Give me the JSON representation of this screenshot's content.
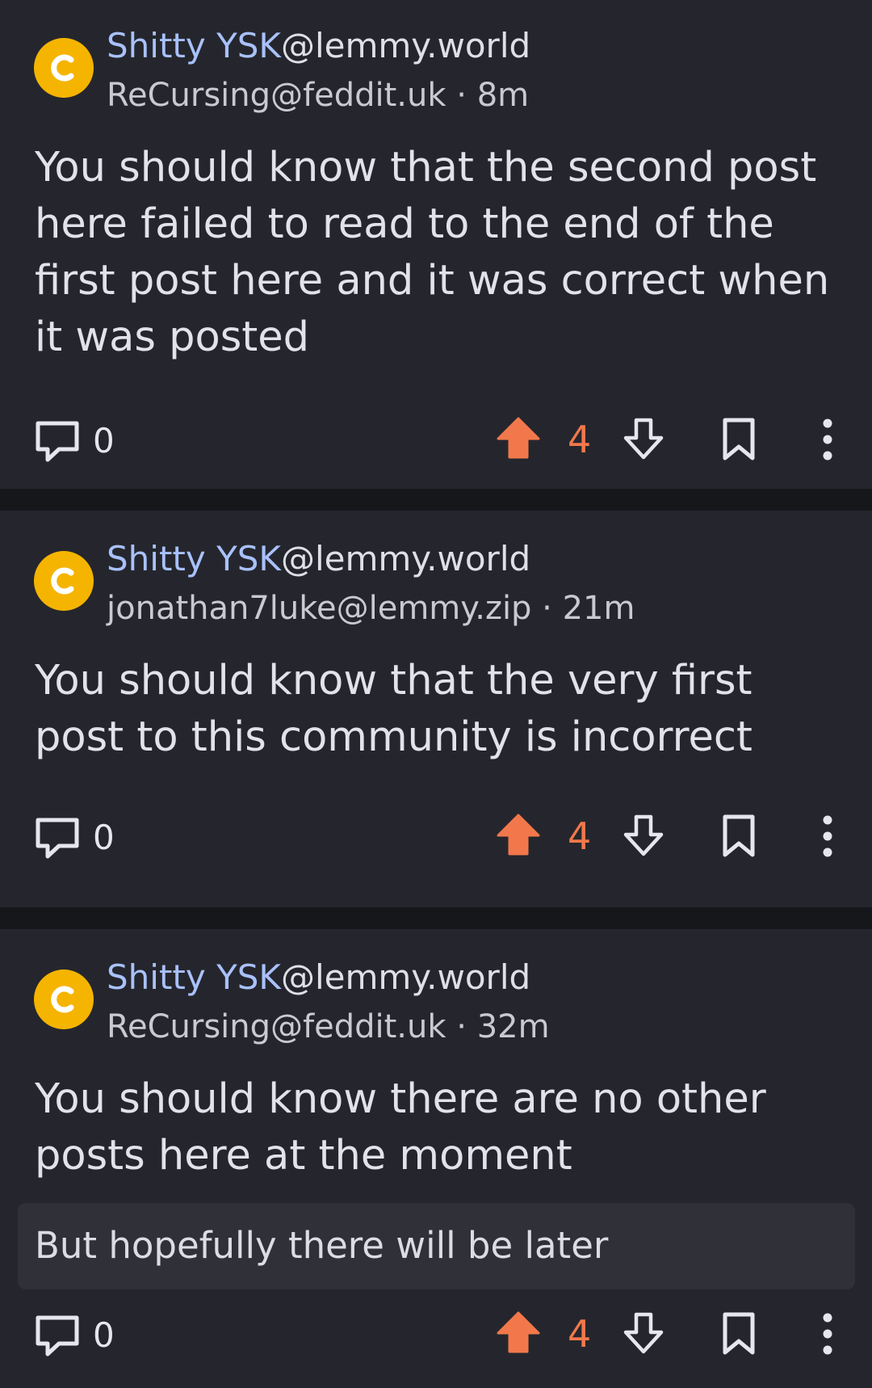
{
  "colors": {
    "background": "#16171b",
    "card": "#25262d",
    "community_name": "#a9c1fb",
    "upvote_accent": "#f2784b",
    "avatar": "#f5b400",
    "body_box": "#2f3038"
  },
  "posts": [
    {
      "avatar_letter": "c",
      "community_name": "Shitty YSK",
      "community_instance": "@lemmy.world",
      "author": "ReCursing@feddit.uk",
      "separator": "·",
      "age": "8m",
      "title": "You should know that the second post here failed to read to the end of the first post here and it was correct when it was posted",
      "comment_count": "0",
      "score": "4",
      "icons": {
        "comments": "comment-icon",
        "upvote": "upvote-arrow-icon",
        "downvote": "downvote-arrow-icon",
        "save": "bookmark-icon",
        "more": "more-vertical-icon"
      }
    },
    {
      "avatar_letter": "c",
      "community_name": "Shitty YSK",
      "community_instance": "@lemmy.world",
      "author": "jonathan7luke@lemmy.zip",
      "separator": "·",
      "age": "21m",
      "title": "You should know that the very first post to this community is incorrect",
      "comment_count": "0",
      "score": "4",
      "icons": {
        "comments": "comment-icon",
        "upvote": "upvote-arrow-icon",
        "downvote": "downvote-arrow-icon",
        "save": "bookmark-icon",
        "more": "more-vertical-icon"
      }
    },
    {
      "avatar_letter": "c",
      "community_name": "Shitty YSK",
      "community_instance": "@lemmy.world",
      "author": "ReCursing@feddit.uk",
      "separator": "·",
      "age": "32m",
      "title": "You should know there are no other posts here at the moment",
      "body": "But hopefully there will be later",
      "comment_count": "0",
      "score": "4",
      "icons": {
        "comments": "comment-icon",
        "upvote": "upvote-arrow-icon",
        "downvote": "downvote-arrow-icon",
        "save": "bookmark-icon",
        "more": "more-vertical-icon"
      }
    }
  ]
}
